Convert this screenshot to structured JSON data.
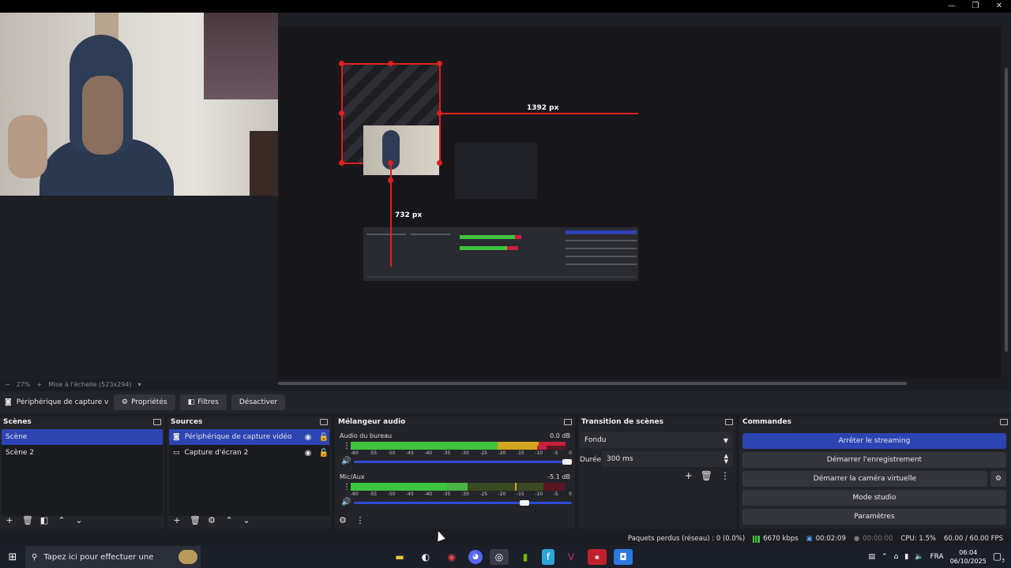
{
  "window": {
    "minimize_glyph": "—",
    "restore_glyph": "❐",
    "close_glyph": "✕"
  },
  "preview": {
    "width_label": "1392 px",
    "height_label": "732 px",
    "zoom": "27%",
    "zoom_minus": "−",
    "zoom_plus": "+",
    "scale_mode": "Mise à l'échelle (523x294)"
  },
  "toolbar": {
    "source_name": "Périphérique de capture vic",
    "properties_label": "Propriétés",
    "filters_label": "Filtres",
    "deactivate_label": "Désactiver"
  },
  "scenes": {
    "title": "Scènes",
    "items": [
      {
        "label": "Scène",
        "selected": true
      },
      {
        "label": "Scène 2",
        "selected": false
      }
    ]
  },
  "sources": {
    "title": "Sources",
    "items": [
      {
        "label": "Périphérique de capture vidéo",
        "selected": true
      },
      {
        "label": "Capture d'écran 2",
        "selected": false
      }
    ]
  },
  "mixer": {
    "title": "Mélangeur audio",
    "scale": [
      "-60",
      "-55",
      "-50",
      "-45",
      "-40",
      "-35",
      "-30",
      "-25",
      "-20",
      "-15",
      "-10",
      "-5",
      "0"
    ],
    "channels": [
      {
        "name": "Audio du bureau",
        "db": "0.0 dB",
        "volume": 1.0
      },
      {
        "name": "Mic/Aux",
        "db": "-5.1 dB",
        "volume": 0.78
      }
    ]
  },
  "transition": {
    "title": "Transition de scènes",
    "type": "Fondu",
    "duration_label": "Durée",
    "duration_value": "300 ms"
  },
  "commands": {
    "title": "Commandes",
    "stop_streaming": "Arrêter le streaming",
    "start_recording": "Démarrer l'enregistrement",
    "start_virtual_camera": "Démarrer la caméra virtuelle",
    "studio_mode": "Mode studio",
    "settings": "Paramètres"
  },
  "status": {
    "dropped_frames": "Paquets perdus (réseau) : 0 (0.0%)",
    "bitrate": "6670 kbps",
    "stream_time": "00:02:09",
    "record_time": "00:00:00",
    "cpu": "CPU: 1.5%",
    "fps": "60.00 / 60.00 FPS"
  },
  "taskbar": {
    "search_placeholder": "Tapez ici pour effectuer une",
    "language": "FRA",
    "time": "06:04",
    "date": "06/10/2025",
    "notification_count": "3"
  },
  "colors": {
    "accent": "#2d44b3",
    "selection": "#e01f1f",
    "meter_green": "#3ec43e",
    "meter_yellow": "#d4a41c",
    "meter_red": "#c8203c"
  }
}
